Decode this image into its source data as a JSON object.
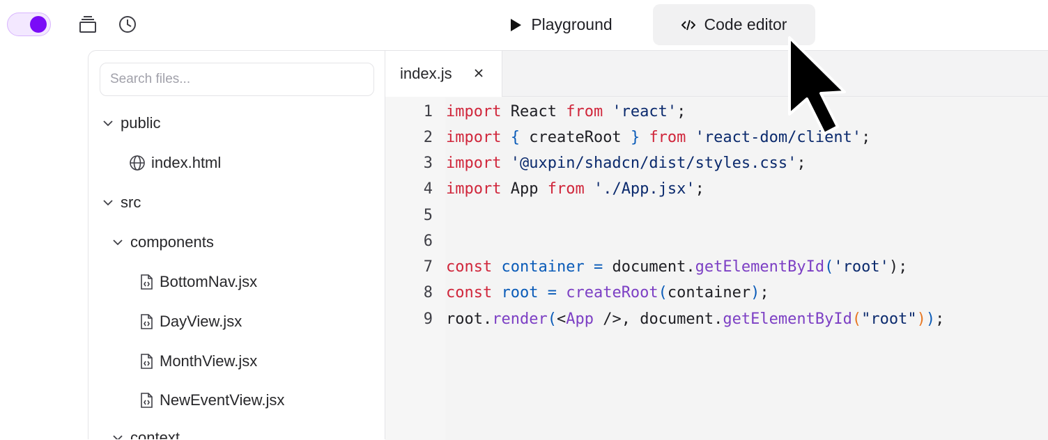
{
  "topbar": {
    "playground_label": "Playground",
    "code_editor_label": "Code editor"
  },
  "explorer": {
    "search_placeholder": "Search files...",
    "tree": [
      {
        "label": "public"
      },
      {
        "label": "index.html"
      },
      {
        "label": "src"
      },
      {
        "label": "components"
      },
      {
        "label": "BottomNav.jsx"
      },
      {
        "label": "DayView.jsx"
      },
      {
        "label": "MonthView.jsx"
      },
      {
        "label": "NewEventView.jsx"
      },
      {
        "label": "context"
      }
    ]
  },
  "editor": {
    "active_tab": "index.js",
    "line_numbers": [
      "1",
      "2",
      "3",
      "4",
      "5",
      "6",
      "7",
      "8",
      "9"
    ],
    "code": {
      "l1": {
        "a": "import",
        "b": " React ",
        "c": "from",
        "d": " ",
        "e": "'react'",
        "f": ";"
      },
      "l2": {
        "a": "import",
        "b": " ",
        "c": "{",
        "d": " createRoot ",
        "e": "}",
        "f": " ",
        "g": "from",
        "h": " ",
        "i": "'react-dom/client'",
        "j": ";"
      },
      "l3": {
        "a": "import",
        "b": " ",
        "c": "'@uxpin/shadcn/dist/styles.css'",
        "d": ";"
      },
      "l4": {
        "a": "import",
        "b": " App ",
        "c": "from",
        "d": " ",
        "e": "'./App.jsx'",
        "f": ";"
      },
      "l7": {
        "a": "const",
        "b": " ",
        "c": "container",
        "d": " ",
        "e": "=",
        "f": " document.",
        "g": "getElementById",
        "h": "(",
        "i": "'root'",
        "j": ");"
      },
      "l8": {
        "a": "const",
        "b": " ",
        "c": "root",
        "d": " ",
        "e": "=",
        "f": " ",
        "g": "createRoot",
        "h": "(",
        "i": "container",
        "j": ")",
        "k": ";"
      },
      "l9": {
        "a": "root.",
        "b": "render",
        "c": "(",
        "d": "<",
        "e": "App",
        "f": " />, document.",
        "g": "getElementById",
        "h": "(",
        "i": "\"root\"",
        "j": ")",
        "k": ")",
        "l": ";"
      }
    }
  },
  "colors": {
    "accent": "#7a0bf7",
    "keyword": "#d0263b",
    "string": "#0b2a6d",
    "identifier": "#0a5bb8",
    "function": "#7c3fc4",
    "bracket_nested": "#e87722"
  },
  "icons": {
    "layers": "layers-icon",
    "history": "clock-icon",
    "play": "play-icon",
    "code": "code-icon",
    "chevron": "chevron-down-icon",
    "globe": "globe-icon",
    "file": "file-code-icon",
    "close": "close-icon",
    "cursor": "mouse-pointer-icon"
  }
}
